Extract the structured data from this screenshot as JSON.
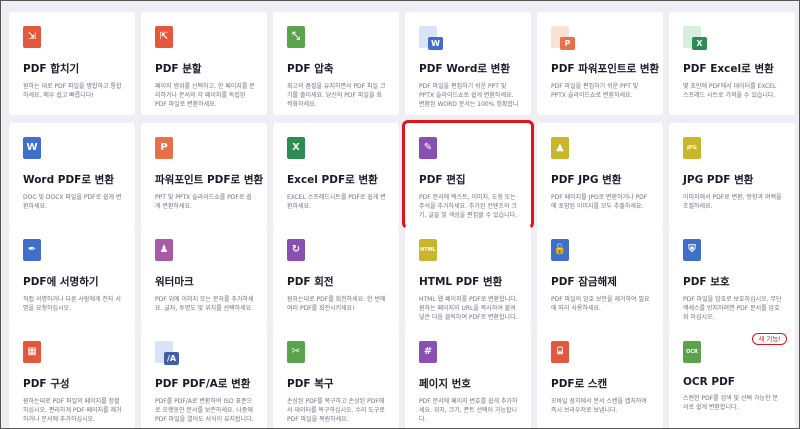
{
  "tools": [
    {
      "title": "PDF 합치기",
      "desc": "원하는 대로 PDF 파일을 병합하고 통합하세요. 매우 쉽고 빠릅니다!",
      "icon": "merge-icon",
      "color": "#e5573d",
      "glyph": "⇲"
    },
    {
      "title": "PDF 분할",
      "desc": "페이지 범위를 선택하고, 한 페이지를 분리하거나 문서의 각 페이지를 독립된 PDF 파일로 변환하세요.",
      "icon": "split-icon",
      "color": "#e5573d",
      "glyph": "⇱"
    },
    {
      "title": "PDF 압축",
      "desc": "최고의 품질을 유지하면서 PDF 파일 크기를 줄이세요. 당신의 PDF 파일을 최적화하세요.",
      "icon": "compress-icon",
      "color": "#5aa34a",
      "glyph": "⤡"
    },
    {
      "title": "PDF Word로 변환",
      "desc": "PDF 파일을 편집하기 쉬운 PPT 및 PPTX 슬라이드쇼로 쉽게 변환하세요. 변환된 WORD 문서는 100% 정확합니다.",
      "icon": "word-icon",
      "color": "#3f6fc8",
      "badge": "W"
    },
    {
      "title": "PDF 파워포인트로 변환",
      "desc": "PDF 파일을 편집하기 쉬운 PPT 및 PPTX 슬라이드쇼로 변환하세요.",
      "icon": "powerpoint-icon",
      "color": "#e5704a",
      "badge": "P"
    },
    {
      "title": "PDF Excel로 변환",
      "desc": "몇 초만에 PDF에서 데이터를 EXCEL 스프레드 시트로 가져올 수 있습니다.",
      "icon": "excel-icon",
      "color": "#2e8c52",
      "badge": "X"
    },
    {
      "title": "Word PDF로 변환",
      "desc": "DOC 및 DOCX 파일을 PDF로 쉽게 변환하세요.",
      "icon": "word-to-pdf-icon",
      "color": "#3f6fc8",
      "glyph": "W"
    },
    {
      "title": "파워포인트 PDF로 변환",
      "desc": "PPT 및 PPTX 슬라이드쇼를 PDF로 쉽게 변환하세요.",
      "icon": "powerpoint-to-pdf-icon",
      "color": "#e5704a",
      "glyph": "P"
    },
    {
      "title": "Excel PDF로 변환",
      "desc": "EXCEL 스프레드시트를 PDF로 쉽게 변환하세요.",
      "icon": "excel-to-pdf-icon",
      "color": "#2e8c52",
      "glyph": "X"
    },
    {
      "title": "PDF 편집",
      "desc": "PDF 문서에 텍스트, 이미지, 도형 또는 주석을 추가하세요. 추가된 컨텐츠의 크기, 글꼴 및 색상을 편집할 수 있습니다.",
      "icon": "edit-icon",
      "color": "#8a4fb2",
      "glyph": "✎"
    },
    {
      "title": "PDF JPG 변환",
      "desc": "PDF 페이지를 JPG로 변환하거나 PDF에 포함된 이미지를 모두 추출하세요.",
      "icon": "pdf-to-jpg-icon",
      "color": "#c9b62a",
      "glyph": "▲"
    },
    {
      "title": "JPG PDF 변환",
      "desc": "이미지에서 PDF로 변환, 방향과 여백을 조절하세요.",
      "icon": "jpg-to-pdf-icon",
      "color": "#c9b62a",
      "glyph": "JPG"
    },
    {
      "title": "PDF에 서명하기",
      "desc": "직접 서명하거나 다른 사람에게 전자 서명을 요청하십시오.",
      "icon": "sign-icon",
      "color": "#3f6fc8",
      "glyph": "✒"
    },
    {
      "title": "워터마크",
      "desc": "PDF 위에 이미지 또는 문자를 추가하세요. 글자, 투명도 및 위치를 선택하세요.",
      "icon": "watermark-icon",
      "color": "#a85aa6",
      "glyph": "♟"
    },
    {
      "title": "PDF 회전",
      "desc": "원하는대로 PDF를 회전하세요. 한 번에 여러 PDF를 회전시키세요!",
      "icon": "rotate-icon",
      "color": "#8a4fb2",
      "glyph": "↻"
    },
    {
      "title": "HTML PDF 변환",
      "desc": "HTML 웹 페이지를 PDF로 변환합니다. 원하는 페이지의 URL을 복사하여 붙여넣은 다음 클릭하여 PDF로 변환합니다.",
      "icon": "html-icon",
      "color": "#c9b62a",
      "glyph": "HTML"
    },
    {
      "title": "PDF 잠금해제",
      "desc": "PDF 파일의 암호 보안을 제거하여 필요에 따라 사용하세요.",
      "icon": "unlock-icon",
      "color": "#3f6fc8",
      "glyph": "🔓"
    },
    {
      "title": "PDF 보호",
      "desc": "PDF 파일을 암호로 보호하십시오. 무단 액세스를 방지하려면 PDF 문서를 암호화 하십시오.",
      "icon": "protect-icon",
      "color": "#3f6fc8",
      "glyph": "⛨"
    },
    {
      "title": "PDF 구성",
      "desc": "원하는대로 PDF 파일의 페이지를 정렬하십시오. 편리하게 PDF 페이지를 제거하거나 문서에 추가하십시오.",
      "icon": "organize-icon",
      "color": "#e5573d",
      "glyph": "▦"
    },
    {
      "title": "PDF PDF/A로 변환",
      "desc": "PDF를 PDF/A로 변환하여 ISO 표준으로 오랫동안 문서를 보존하세요. 나중에 PDF 파일을 열어도 서식이 유지됩니다.",
      "icon": "pdfa-icon",
      "color": "#3f5fa8",
      "badge": "/A"
    },
    {
      "title": "PDF 복구",
      "desc": "손상된 PDF를 복구하고 손상된 PDF에서 데이터를 복구하십시오. 수리 도구로 PDF 파일을 복원하세요.",
      "icon": "repair-icon",
      "color": "#5aa34a",
      "glyph": "✂"
    },
    {
      "title": "페이지 번호",
      "desc": "PDF 문서에 페이지 번호를 쉽게 추가하세요. 위치, 크기, 폰트 선택이 가능합니다.",
      "icon": "page-number-icon",
      "color": "#8a4fb2",
      "glyph": "#"
    },
    {
      "title": "PDF로 스캔",
      "desc": "모바일 장치에서 문서 스캔을 캡처하여 즉시 브라우저로 보냅니다.",
      "icon": "scan-icon",
      "color": "#e5573d",
      "glyph": "⌸"
    },
    {
      "title": "OCR PDF",
      "desc": "스캔한 PDF를 검색 및 선택 가능한 문서로 쉽게 변환합니다.",
      "icon": "ocr-icon",
      "color": "#5aa34a",
      "glyph": "OCR",
      "tag": "새 기능!"
    }
  ],
  "highlighted": "PDF 편집"
}
